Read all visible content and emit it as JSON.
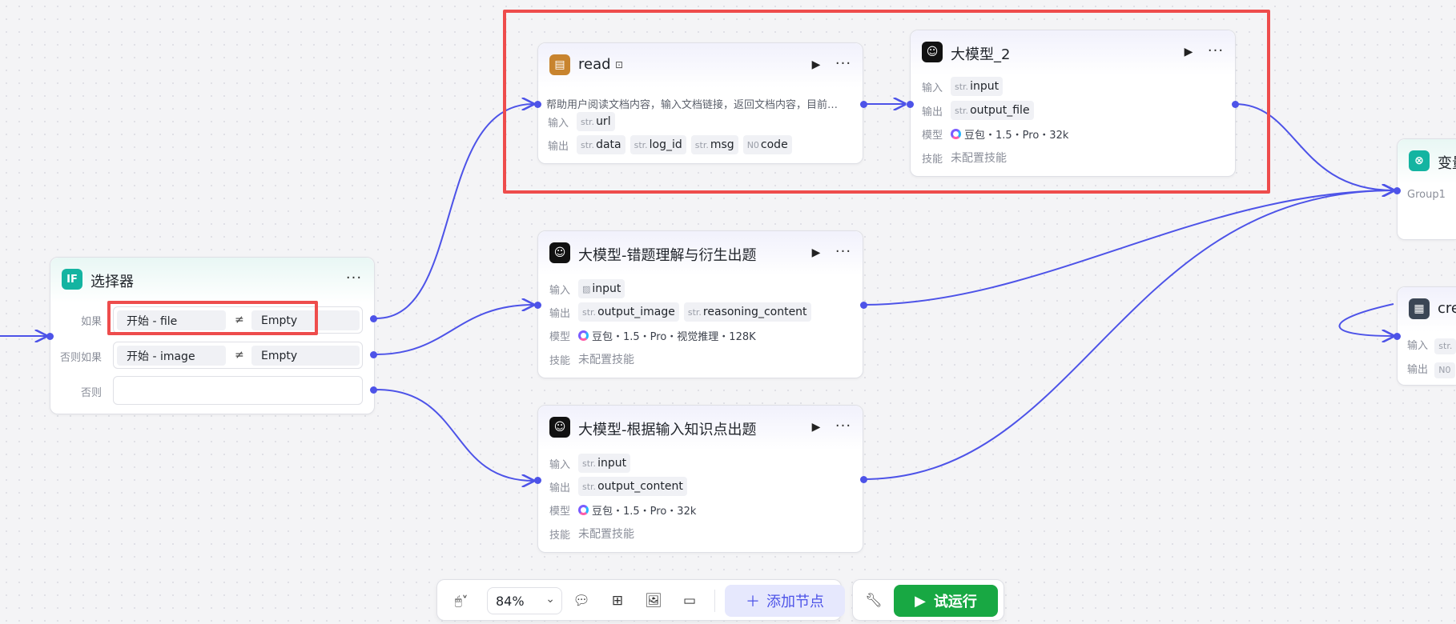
{
  "selector_node": {
    "title": "选择器",
    "icon": "IF",
    "conditions": [
      {
        "label": "如果",
        "variable": "开始 - file",
        "operator": "≠",
        "value": "Empty"
      },
      {
        "label": "否则如果",
        "variable": "开始 - image",
        "operator": "≠",
        "value": "Empty"
      },
      {
        "label": "否则",
        "variable": "",
        "operator": "",
        "value": ""
      }
    ]
  },
  "read_node": {
    "title": "read",
    "description": "帮助用户阅读文档内容，输入文档链接，返回文档内容，目前…",
    "input_label": "输入",
    "inputs": [
      {
        "type": "str.",
        "name": "url"
      }
    ],
    "output_label": "输出",
    "outputs": [
      {
        "type": "str.",
        "name": "data"
      },
      {
        "type": "str.",
        "name": "log_id"
      },
      {
        "type": "str.",
        "name": "msg"
      },
      {
        "type": "N0",
        "name": "code"
      }
    ]
  },
  "llm2_node": {
    "title": "大模型_2",
    "input_label": "输入",
    "inputs": [
      {
        "type": "str.",
        "name": "input"
      }
    ],
    "output_label": "输出",
    "outputs": [
      {
        "type": "str.",
        "name": "output_file"
      }
    ],
    "model_label": "模型",
    "model": "豆包・1.5・Pro・32k",
    "skill_label": "技能",
    "skill": "未配置技能"
  },
  "llm_error_node": {
    "title": "大模型-错题理解与衍生出题",
    "input_label": "输入",
    "inputs": [
      {
        "type": "img",
        "name": "input"
      }
    ],
    "output_label": "输出",
    "outputs": [
      {
        "type": "str.",
        "name": "output_image"
      },
      {
        "type": "str.",
        "name": "reasoning_content"
      }
    ],
    "model_label": "模型",
    "model": "豆包・1.5・Pro・视觉推理・128K",
    "skill_label": "技能",
    "skill": "未配置技能"
  },
  "llm_knowledge_node": {
    "title": "大模型-根据输入知识点出题",
    "input_label": "输入",
    "inputs": [
      {
        "type": "str.",
        "name": "input"
      }
    ],
    "output_label": "输出",
    "outputs": [
      {
        "type": "str.",
        "name": "output_content"
      }
    ],
    "model_label": "模型",
    "model": "豆包・1.5・Pro・32k",
    "skill_label": "技能",
    "skill": "未配置技能"
  },
  "var_node": {
    "title": "变量",
    "group": "Group1"
  },
  "create_node": {
    "title": "cre",
    "input_label": "输入",
    "input_type": "str.",
    "output_label": "输出",
    "output_type": "N0"
  },
  "toolbar": {
    "zoom": "84%",
    "add_node_label": "添加节点",
    "test_run_label": "试运行"
  },
  "colors": {
    "edge": "#4d53e8",
    "highlight": "#ee4c4c",
    "run_button": "#18a843",
    "add_button_bg": "#e6e8fd"
  }
}
